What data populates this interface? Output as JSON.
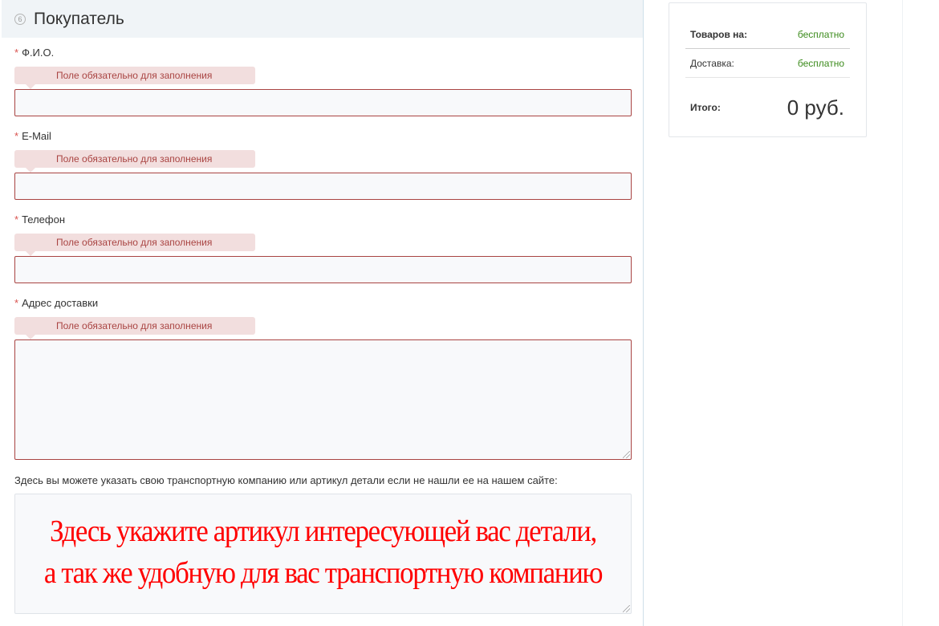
{
  "section": {
    "step": "6",
    "title": "Покупатель"
  },
  "fields": [
    {
      "label": "Ф.И.О.",
      "required_mark": "*",
      "error": "Поле обязательно для заполнения",
      "value": ""
    },
    {
      "label": "E-Mail",
      "required_mark": "*",
      "error": "Поле обязательно для заполнения",
      "value": ""
    },
    {
      "label": "Телефон",
      "required_mark": "*",
      "error": "Поле обязательно для заполнения",
      "value": ""
    },
    {
      "label": "Адрес доставки",
      "required_mark": "*",
      "error": "Поле обязательно для заполнения",
      "value": ""
    }
  ],
  "comment": {
    "note": "Здесь вы можете указать свою транспортную компанию или артикул детали если не нашли ее на нашем сайте:",
    "line1": "Здесь укажите артикул интересующей вас детали,",
    "line2": "а так же удобную для вас транспортную компанию"
  },
  "summary": {
    "goods_label": "Товаров на:",
    "goods_value": "бесплатно",
    "delivery_label": "Доставка:",
    "delivery_value": "бесплатно",
    "total_label": "Итого:",
    "total_value": "0 руб."
  },
  "colors": {
    "error_bg": "#f2dede",
    "error_text": "#a94442",
    "required": "#d9534f",
    "free_text": "#3c8b1c",
    "comment_text": "#ff0000"
  }
}
